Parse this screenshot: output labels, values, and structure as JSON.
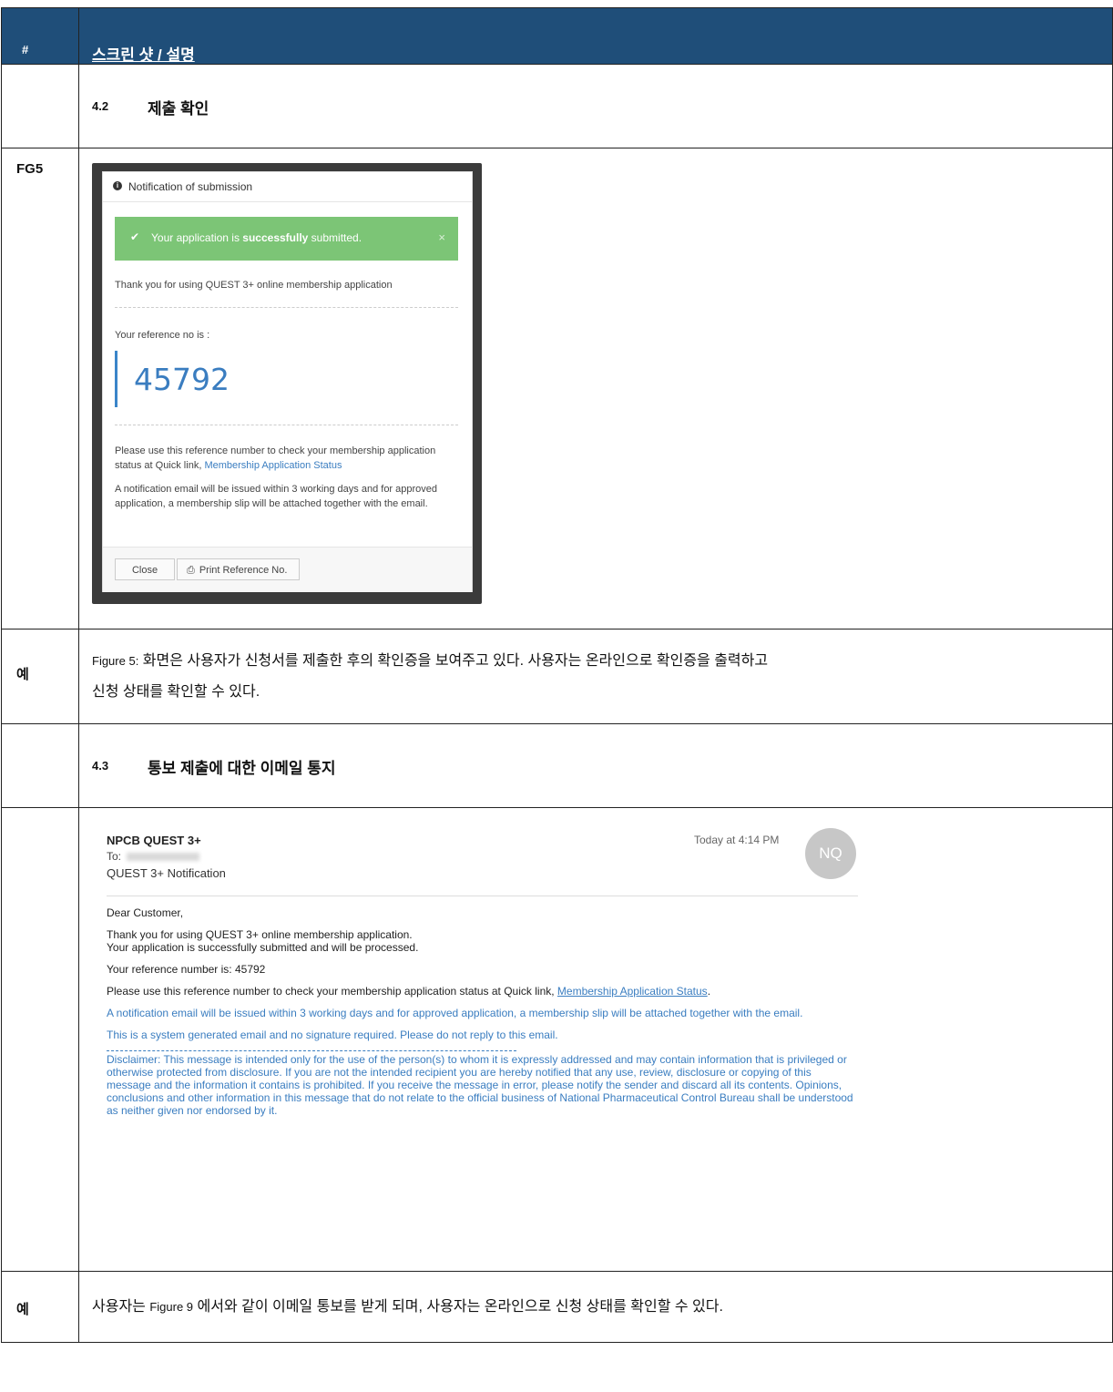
{
  "header": {
    "num": "#",
    "title": "스크린 샷 / 설명"
  },
  "sections": [
    {
      "num": "4.2",
      "title": "제출 확인"
    },
    {
      "num": "4.3",
      "title": "통보 제출에 대한 이메일 통지"
    }
  ],
  "rows": {
    "fg5_label": "FG5",
    "example_label": "예",
    "desc1_line1": "화면은 사용자가 신청서를 제출한 후의 확인증을 보여주고 있다. 사용자는 온라인으로 확인증을 출력하고",
    "desc1_prefix": "Figure 5:",
    "desc1_line2": "신청 상태를 확인할 수 있다.",
    "desc2_a": "사용자는",
    "desc2_fig": "Figure 9",
    "desc2_b": "에서와 같이 이메일 통보를 받게 되며, 사용자는 온라인으로 신청 상태를 확인할 수 있다."
  },
  "modal": {
    "title": "Notification of submission",
    "info_icon": "info-circle-icon",
    "alert_pre": "Your application is ",
    "alert_bold": "successfully",
    "alert_post": " submitted.",
    "alert_close": "×",
    "thanks": "Thank you for using QUEST 3+ online membership application",
    "ref_label": "Your reference no is :",
    "ref_number": "45792",
    "use_ref": "Please use this reference number to check your membership application status at Quick link,",
    "use_ref_link": "Membership Application Status",
    "notify": "A notification email will be issued within 3 working days and for approved application, a membership slip will be attached together with the email.",
    "close_button": "Close",
    "print_button": "Print Reference No."
  },
  "email": {
    "from": "NPCB QUEST 3+",
    "to_label": "To:",
    "subject": "QUEST 3+ Notification",
    "date": "Today at 4:14 PM",
    "avatar": "NQ",
    "greeting": "Dear Customer,",
    "thanks1": "Thank you for using QUEST 3+ online membership application.",
    "thanks2": "Your application is successfully submitted and will be processed.",
    "ref": "Your reference number is: 45792",
    "use_ref": "Please use this reference number to check your membership application status at Quick link,",
    "use_ref_link": "Membership Application Status",
    "notify": "A notification email will be issued within 3 working days and for approved application, a membership slip will be attached together with the email.",
    "system": "This is a system generated email and no signature required. Please do not reply to this email.",
    "disclaimer": "Disclaimer: This message is intended only for the use of the person(s) to whom it is expressly addressed and may contain information that is privileged or otherwise protected from disclosure. If you are not the intended recipient you are hereby notified that any use, review, disclosure or copying of this message and the information it contains is prohibited. If you receive the message in error, please notify the sender and discard all its contents. Opinions, conclusions and other information in this message that do not relate to the official business of National Pharmaceutical Control Bureau shall be understood as neither given nor endorsed by it."
  },
  "colors": {
    "header_bg": "#1f4e79",
    "alert_green": "#7cc576",
    "link_blue": "#3a7dc0"
  }
}
